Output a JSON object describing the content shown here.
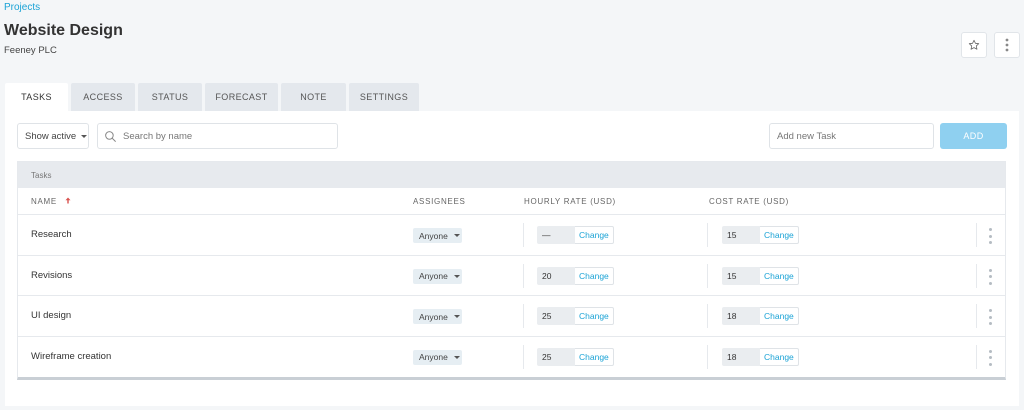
{
  "breadcrumb": "Projects",
  "project": {
    "title": "Website Design",
    "client": "Feeney PLC"
  },
  "header_actions": {
    "star_icon": "star-icon",
    "more_icon": "vertical-dots-icon"
  },
  "tabs": [
    {
      "label": "TASKS",
      "active": true
    },
    {
      "label": "ACCESS",
      "active": false
    },
    {
      "label": "STATUS",
      "active": false
    },
    {
      "label": "FORECAST",
      "active": false
    },
    {
      "label": "NOTE",
      "active": false
    },
    {
      "label": "SETTINGS",
      "active": false
    }
  ],
  "filters": {
    "status_value": "Show active",
    "search_placeholder": "Search by name",
    "new_task_placeholder": "Add new Task",
    "add_label": "ADD"
  },
  "table": {
    "caption": "Tasks",
    "columns": {
      "name": "NAME",
      "assignees": "ASSIGNEES",
      "hourly_rate": "HOURLY RATE (USD)",
      "cost_rate": "COST RATE (USD)"
    },
    "sort_icon": "sort-up-arrow-icon",
    "change_label": "Change",
    "rows": [
      {
        "name": "Research",
        "assignee": "Anyone",
        "hourly_rate": "—",
        "cost_rate": "15"
      },
      {
        "name": "Revisions",
        "assignee": "Anyone",
        "hourly_rate": "20",
        "cost_rate": "15"
      },
      {
        "name": "UI design",
        "assignee": "Anyone",
        "hourly_rate": "25",
        "cost_rate": "18"
      },
      {
        "name": "Wireframe creation",
        "assignee": "Anyone",
        "hourly_rate": "25",
        "cost_rate": "18"
      }
    ]
  },
  "colors": {
    "accent": "#1ba3d6",
    "add_button": "#8fd0f0",
    "page_background": "#f4f6f8"
  }
}
